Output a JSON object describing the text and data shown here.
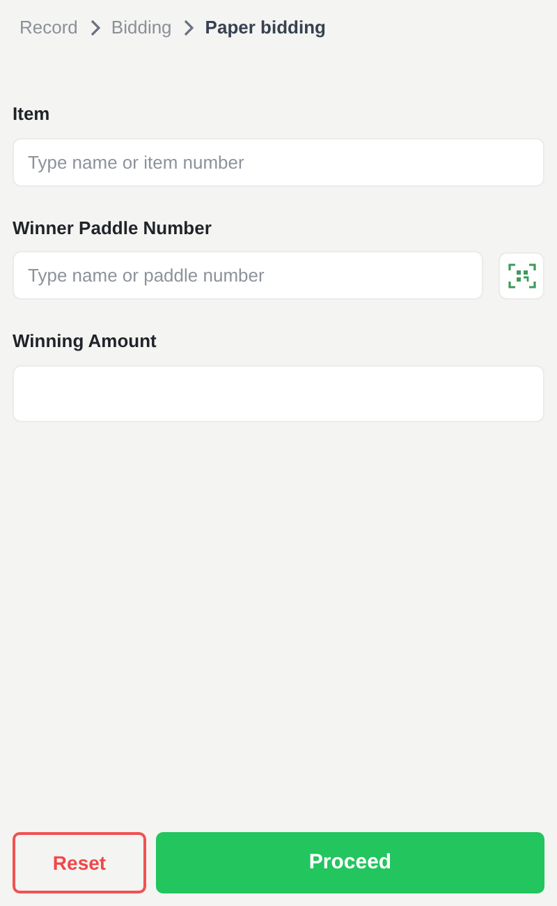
{
  "breadcrumb": [
    {
      "label": "Record",
      "current": false
    },
    {
      "label": "Bidding",
      "current": false
    },
    {
      "label": "Paper bidding",
      "current": true
    }
  ],
  "fields": [
    {
      "label": "Item",
      "placeholder": "Type name or item number",
      "scan_button": false
    },
    {
      "label": "Winner Paddle Number",
      "placeholder": "Type name or paddle number",
      "scan_button": true
    },
    {
      "label": "Winning Amount",
      "scan_button": false
    }
  ],
  "buttons": [
    {
      "label": "Reset",
      "kind": "outline"
    },
    {
      "label": "Proceed",
      "kind": "primary"
    }
  ]
}
